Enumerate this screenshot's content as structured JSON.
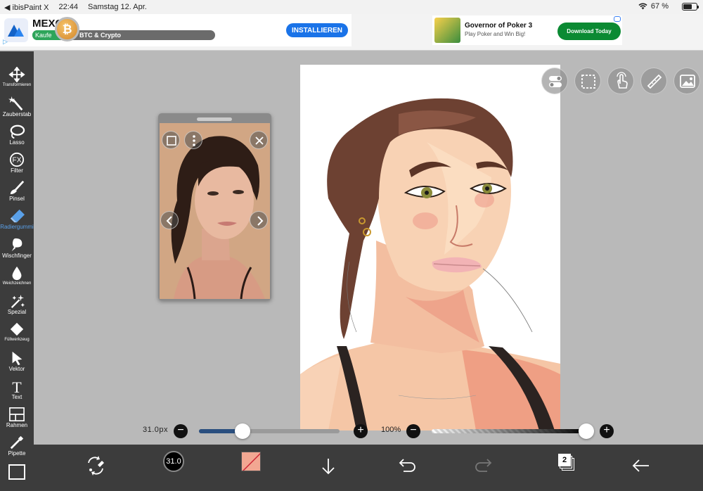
{
  "status_bar": {
    "back_app": "◀ ibisPaint X",
    "time": "22:44",
    "date": "Samstag 12. Apr.",
    "battery": "67 %",
    "battery_level": 0.67
  },
  "ads": {
    "left": {
      "brand": "MEXC",
      "pill_green": "Kaufe",
      "pill_text": "BTC & Crypto",
      "coin_symbol": "₿",
      "button": "INSTALLIEREN"
    },
    "right": {
      "title": "Governor of Poker 3",
      "subtitle": "Play Poker and Win Big!",
      "button": "Download Today"
    }
  },
  "toolbar": {
    "items": [
      {
        "label": "Transformieren",
        "icon": "move-icon"
      },
      {
        "label": "Zauberstab",
        "icon": "magic-wand-icon"
      },
      {
        "label": "Lasso",
        "icon": "lasso-icon"
      },
      {
        "label": "Filter",
        "icon": "fx-icon",
        "glyph": "FX"
      },
      {
        "label": "Pinsel",
        "icon": "brush-icon"
      },
      {
        "label": "Radiergummi",
        "icon": "eraser-icon",
        "active": true
      },
      {
        "label": "Wischfinger",
        "icon": "smudge-icon"
      },
      {
        "label": "Weichzeichnen",
        "icon": "blur-drop-icon"
      },
      {
        "label": "Spezial",
        "icon": "special-icon"
      },
      {
        "label": "Füllwerkzeug",
        "icon": "fill-icon"
      },
      {
        "label": "Vektor",
        "icon": "vector-cursor-icon"
      },
      {
        "label": "Text",
        "icon": "text-icon",
        "glyph": "T"
      },
      {
        "label": "Rahmen",
        "icon": "frame-icon"
      },
      {
        "label": "Pipette",
        "icon": "eyedropper-icon"
      }
    ]
  },
  "brush": {
    "size_label": "31.0px",
    "size_badge": "31.0",
    "size_fraction": 0.31,
    "opacity_label": "100%",
    "opacity_fraction": 1.0
  },
  "colors": {
    "accent": "#5aa0e8",
    "toolbar": "#3c3c3c",
    "primary_color": "#f2a792"
  },
  "layers": {
    "count": "2"
  }
}
